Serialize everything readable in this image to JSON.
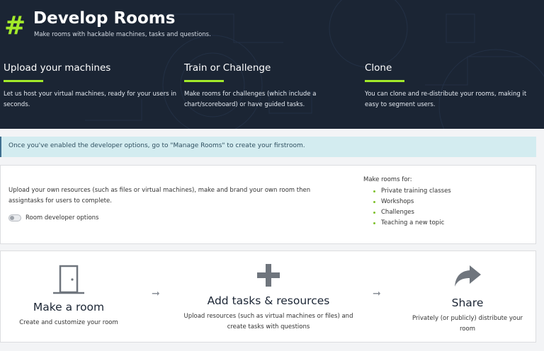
{
  "hero": {
    "icon": "hash-icon",
    "title": "Develop Rooms",
    "subtitle": "Make rooms with hackable machines, tasks and questions.",
    "accent": "#a3ea2a",
    "features": [
      {
        "title": "Upload your machines",
        "text": "Let us host your virtual machines, ready for your users in seconds."
      },
      {
        "title": "Train or Challenge",
        "text": "Make rooms for challenges (which include a chart/scoreboard) or have guided tasks."
      },
      {
        "title": "Clone",
        "text": "You can clone and re-distribute your rooms, making it easy to segment users."
      }
    ]
  },
  "alert": {
    "text": "Once you've enabled the developer options, go to \"Manage Rooms\" to create your firstroom."
  },
  "developer": {
    "description": "Upload your own resources (such as files or virtual machines), make and brand your own room then assigntasks for users to complete.",
    "toggle_label": "Room developer options",
    "toggle_on": false,
    "make_rooms_title": "Make rooms for:",
    "make_rooms_items": [
      "Private training classes",
      "Workshops",
      "Challenges",
      "Teaching a new topic"
    ]
  },
  "steps": [
    {
      "icon": "door-icon",
      "title": "Make a room",
      "text": "Create and customize your room"
    },
    {
      "icon": "plus-icon",
      "title": "Add tasks & resources",
      "text": "Upload resources (such as virtual machines or files) and create tasks with questions"
    },
    {
      "icon": "share-icon",
      "title": "Share",
      "text": "Privately (or publicly) distribute your room"
    }
  ]
}
